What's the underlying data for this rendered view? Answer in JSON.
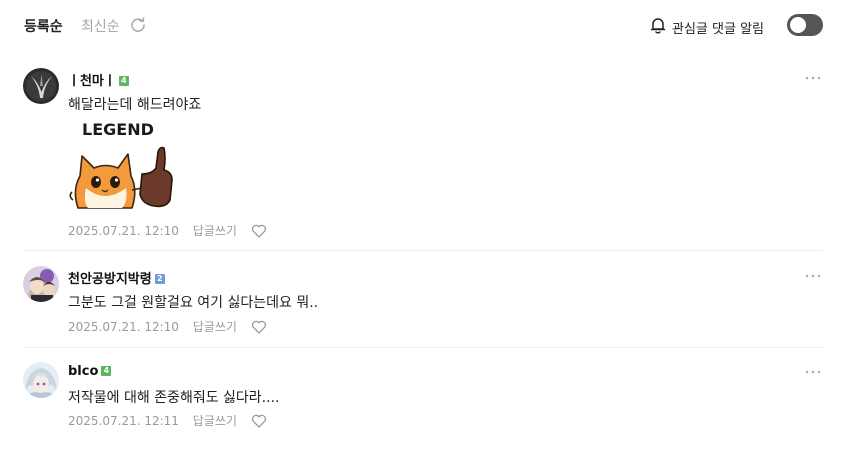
{
  "header": {
    "sort_registered": "등록순",
    "sort_latest": "최신순",
    "watch_label": "관심글 댓글 알림",
    "watch_toggle_on": false
  },
  "comments": [
    {
      "nickname": "ㅣ천마ㅣ",
      "level": "4",
      "level_color": "#5cb85c",
      "text": "해달라는데 해드려야죠",
      "sticker_text": "LEGEND",
      "date": "2025.07.21. 12:10",
      "reply_label": "답글쓰기"
    },
    {
      "nickname": "천안공방지박령",
      "level": "2",
      "level_color": "#6c9bd8",
      "text": "그분도 그걸 원할걸요 여기 싫다는데요 뭐..",
      "date": "2025.07.21. 12:10",
      "reply_label": "답글쓰기"
    },
    {
      "nickname": "blco",
      "level": "4",
      "level_color": "#5cb85c",
      "text": "저작물에 대해 존중해줘도 싫다라....",
      "date": "2025.07.21. 12:11",
      "reply_label": "답글쓰기"
    }
  ]
}
